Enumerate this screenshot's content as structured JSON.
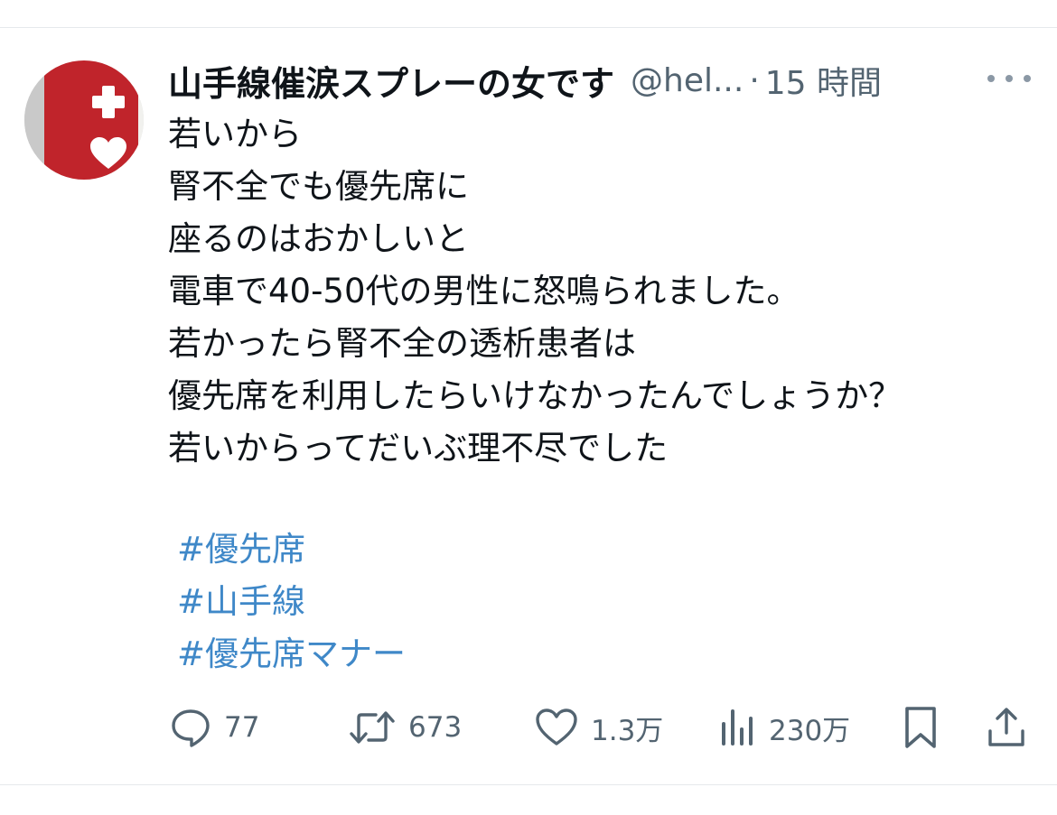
{
  "post": {
    "display_name": "山手線催涙スプレーの女です",
    "handle": "@hel...",
    "separator": "·",
    "time": "15 時間",
    "lines": [
      "若いから",
      "腎不全でも優先席に",
      "座るのはおかしいと",
      "電車で40-50代の男性に怒鳴られました。",
      "若かったら腎不全の透析患者は",
      "優先席を利用したらいけなかったんでしょうか？",
      "若いからってだいぶ理不尽でした"
    ],
    "hashtags": [
      "#優先席",
      "#山手線",
      "#優先席マナー"
    ]
  },
  "actions": {
    "replies": "77",
    "reposts": "673",
    "likes": "1.3万",
    "views": "230万"
  },
  "icons": {
    "reply": "speech-bubble-icon",
    "repost": "repost-arrows-icon",
    "like": "heart-icon",
    "views": "bar-chart-icon",
    "bookmark": "bookmark-icon",
    "share": "share-upload-icon",
    "more": "ellipsis-icon"
  },
  "colors": {
    "text": "#0f1419",
    "secondary": "#536471",
    "hashtag": "#3f88c8",
    "avatar_red": "#c0242b"
  }
}
